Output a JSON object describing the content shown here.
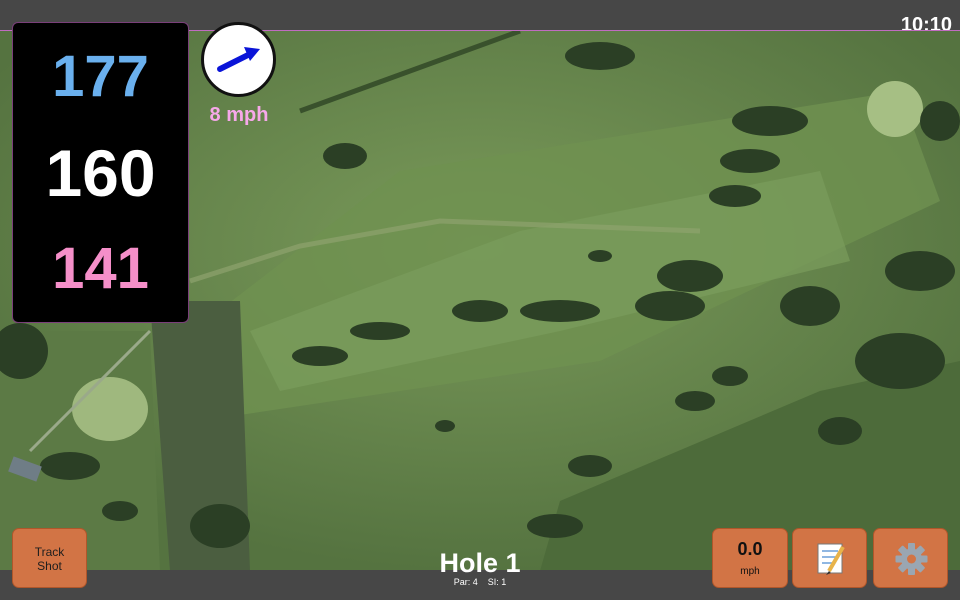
{
  "status": {
    "time": "10:10"
  },
  "distances": {
    "back": "177",
    "middle": "160",
    "front": "141"
  },
  "wind": {
    "speed": "8 mph",
    "icon": "wind-arrow-icon"
  },
  "hole": {
    "title": "Hole 1",
    "par_label": "Par:",
    "par": "4",
    "si_label": "SI:",
    "si": "1"
  },
  "buttons": {
    "track_shot": [
      "Track",
      "Shot"
    ],
    "speed_value": "0.0",
    "speed_unit": "mph",
    "notes_icon": "notepad-icon",
    "settings_icon": "gear-icon"
  },
  "colors": {
    "back_distance": "#6ab0ee",
    "middle_distance": "#ffffff",
    "front_distance": "#f58fc9",
    "wind_text": "#f7a8ea",
    "button": "#d27445",
    "bar": "#474747"
  }
}
